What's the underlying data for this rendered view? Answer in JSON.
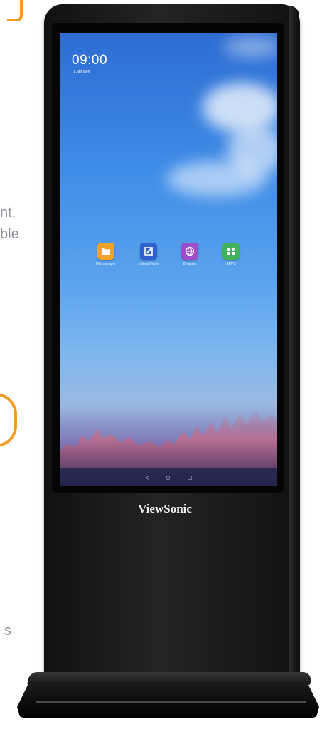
{
  "left_page_text": {
    "line1": "nt,",
    "line2": "ble",
    "line3": "s"
  },
  "screen": {
    "time": "09:00",
    "date": "1 Jan Mon",
    "apps": [
      {
        "label": "Filemanager",
        "color": "#f0a32a",
        "icon": "folder-icon"
      },
      {
        "label": "vBoard Note",
        "color": "#2f5fd0",
        "icon": "note-pen-icon"
      },
      {
        "label": "Browser",
        "color": "#9b4fc8",
        "icon": "globe-icon"
      },
      {
        "label": "APPS",
        "color": "#3fb25b",
        "icon": "apps-grid-icon"
      }
    ],
    "nav": {
      "back": "◁",
      "home": "○",
      "recent": "□"
    }
  },
  "brand": "ViewSonic",
  "colors": {
    "accent_orange": "#f59a24",
    "bezel": "#111111"
  }
}
